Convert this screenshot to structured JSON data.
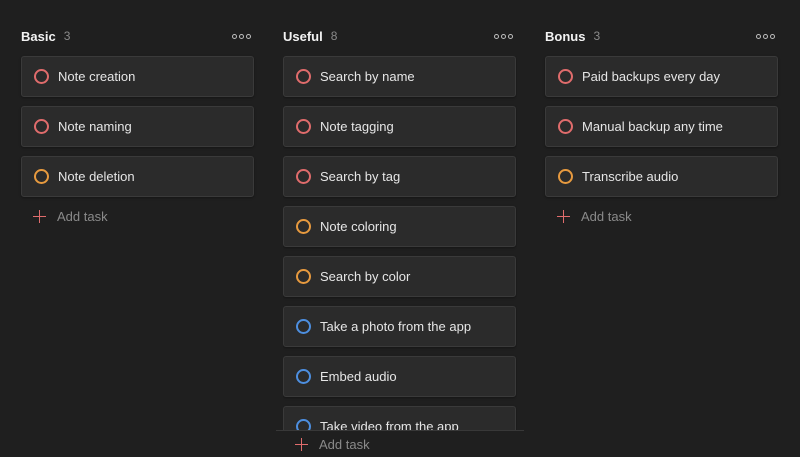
{
  "colors": {
    "background": "#1f1f1f",
    "card": "#2b2b2b",
    "priority_1": "#e06c6c",
    "priority_2": "#e79a3f",
    "priority_3": "#4d8fe0"
  },
  "columns": [
    {
      "title": "Basic",
      "count": "3",
      "tasks": [
        {
          "text": "Note creation",
          "priority": 1
        },
        {
          "text": "Note naming",
          "priority": 1
        },
        {
          "text": "Note deletion",
          "priority": 2
        }
      ],
      "add_label": "Add task"
    },
    {
      "title": "Useful",
      "count": "8",
      "tasks": [
        {
          "text": "Search by name",
          "priority": 1
        },
        {
          "text": "Note tagging",
          "priority": 1
        },
        {
          "text": "Search by tag",
          "priority": 1
        },
        {
          "text": "Note coloring",
          "priority": 2
        },
        {
          "text": "Search by color",
          "priority": 2
        },
        {
          "text": "Take a photo from the app",
          "priority": 3
        },
        {
          "text": "Embed audio",
          "priority": 3
        },
        {
          "text": "Take video from the app",
          "priority": 3
        }
      ],
      "add_label": "Add task"
    },
    {
      "title": "Bonus",
      "count": "3",
      "tasks": [
        {
          "text": "Paid backups every day",
          "priority": 1
        },
        {
          "text": "Manual backup any time",
          "priority": 1
        },
        {
          "text": "Transcribe audio",
          "priority": 2
        }
      ],
      "add_label": "Add task"
    }
  ],
  "icons": {
    "more": "more-horizontal-icon",
    "check": "priority-circle-icon",
    "add": "plus-icon"
  }
}
